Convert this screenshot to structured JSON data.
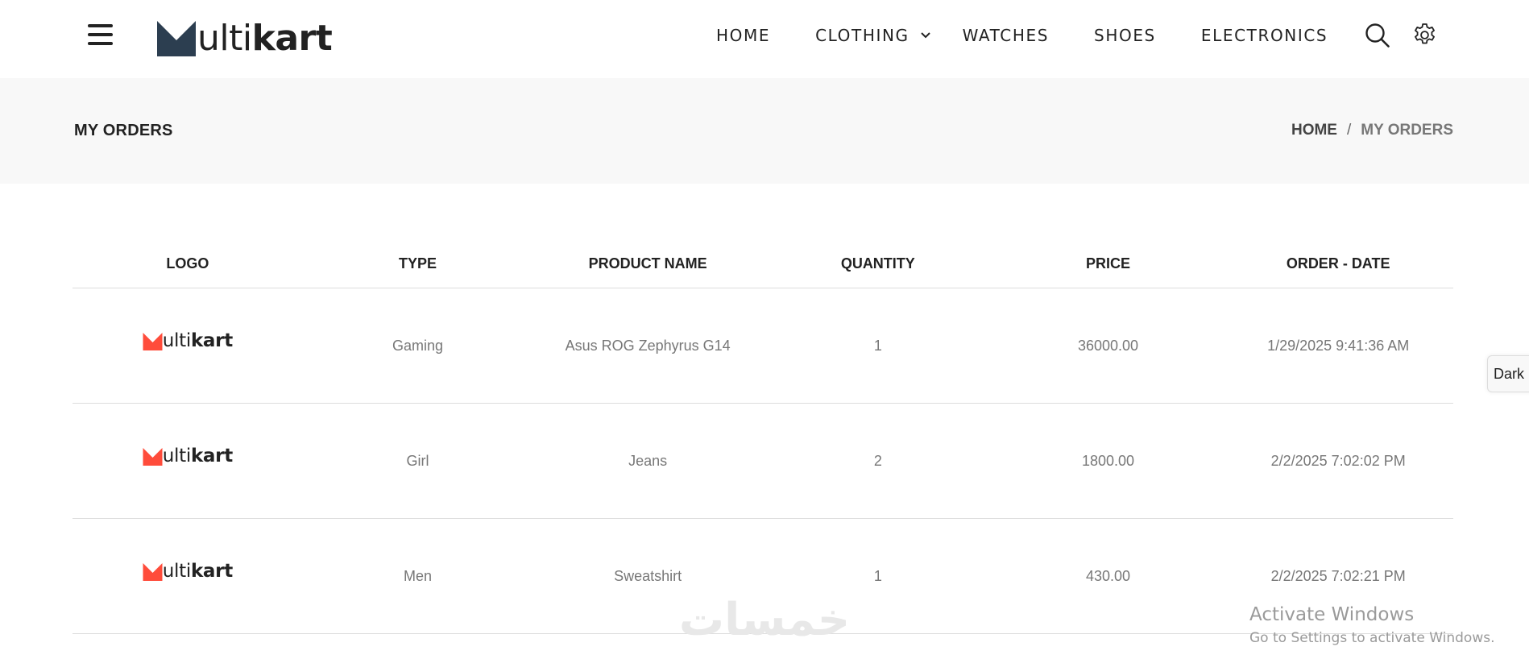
{
  "header": {
    "logo": {
      "first_letter": "M",
      "light_text": "ulti",
      "bold_text": "kart"
    },
    "nav": [
      {
        "label": "HOME"
      },
      {
        "label": "CLOTHING",
        "has_submenu": true
      },
      {
        "label": "WATCHES"
      },
      {
        "label": "SHOES"
      },
      {
        "label": "ELECTRONICS"
      }
    ],
    "icons": [
      "menu-icon",
      "search-icon",
      "gear-icon",
      "chevron-down-icon"
    ]
  },
  "title_bar": {
    "page_title": "MY ORDERS",
    "breadcrumb": {
      "home": "HOME",
      "separator": "/",
      "current": "MY ORDERS"
    }
  },
  "orders_table": {
    "columns": [
      "LOGO",
      "TYPE",
      "PRODUCT NAME",
      "QUANTITY",
      "PRICE",
      "ORDER - DATE"
    ],
    "rows": [
      {
        "logo": {
          "light_text": "ulti",
          "bold_text": "kart"
        },
        "type": "Gaming",
        "product_name": "Asus ROG Zephyrus G14",
        "quantity": "1",
        "price": "36000.00",
        "order_date": "1/29/2025 9:41:36 AM"
      },
      {
        "logo": {
          "light_text": "ulti",
          "bold_text": "kart"
        },
        "type": "Girl",
        "product_name": "Jeans",
        "quantity": "2",
        "price": "1800.00",
        "order_date": "2/2/2025 7:02:02 PM"
      },
      {
        "logo": {
          "light_text": "ulti",
          "bold_text": "kart"
        },
        "type": "Men",
        "product_name": "Sweatshirt",
        "quantity": "1",
        "price": "430.00",
        "order_date": "2/2/2025 7:02:21 PM"
      }
    ]
  },
  "theme_toggle": {
    "label": "Dark"
  },
  "watermarks": {
    "site_mark": "خمسات",
    "activate_title": "Activate Windows",
    "activate_subtitle": "Go to Settings to activate Windows."
  },
  "colors": {
    "text_dark": "#222222",
    "text_muted": "#777777",
    "title_bar_bg": "#f8f8f8",
    "logo_mark_header": "#2c3e50",
    "logo_mark_row": "#ff4c3b",
    "divider": "#dddddd"
  }
}
